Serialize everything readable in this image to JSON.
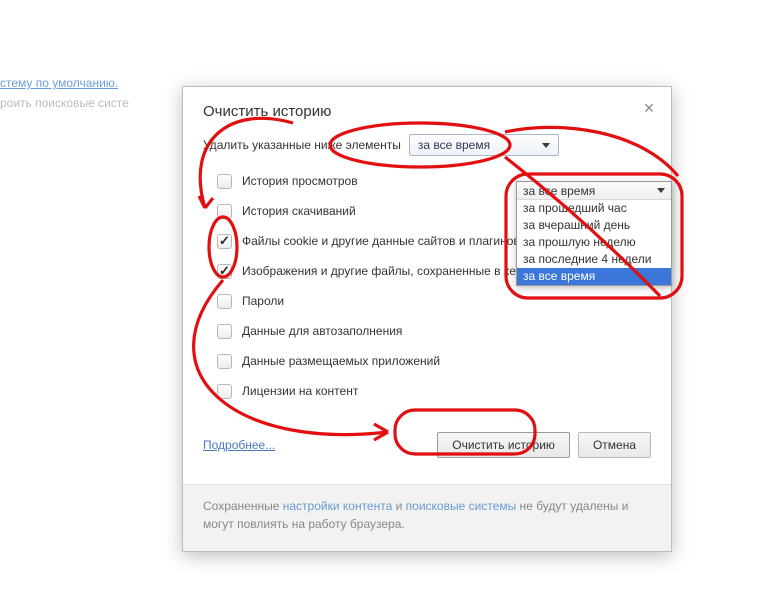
{
  "background": {
    "line1": "стему по умолчанию.",
    "line2": "роить поисковые систе"
  },
  "dialog": {
    "title": "Очистить историю",
    "delete_label": "Удалить указанные ниже элементы",
    "time_range_selected": "за все время",
    "time_range_options": [
      "за прошедший час",
      "за вчерашний день",
      "за прошлую неделю",
      "за последние 4 недели",
      "за все время"
    ],
    "items": [
      {
        "label": "История просмотров",
        "checked": false
      },
      {
        "label": "История скачиваний",
        "checked": false
      },
      {
        "label": "Файлы cookie и другие данные сайтов и плагинов",
        "checked": true
      },
      {
        "label": "Изображения и другие файлы, сохраненные в кеше",
        "checked": true
      },
      {
        "label": "Пароли",
        "checked": false
      },
      {
        "label": "Данные для автозаполнения",
        "checked": false
      },
      {
        "label": "Данные размещаемых приложений",
        "checked": false
      },
      {
        "label": "Лицензии на контент",
        "checked": false
      }
    ],
    "more_link": "Подробнее...",
    "clear_button": "Очистить историю",
    "cancel_button": "Отмена",
    "footer_prefix": "Сохраненные ",
    "footer_link1": "настройки контента",
    "footer_mid": " и ",
    "footer_link2": "поисковые системы",
    "footer_suffix": " не будут удалены и могут повлиять на работу браузера."
  }
}
